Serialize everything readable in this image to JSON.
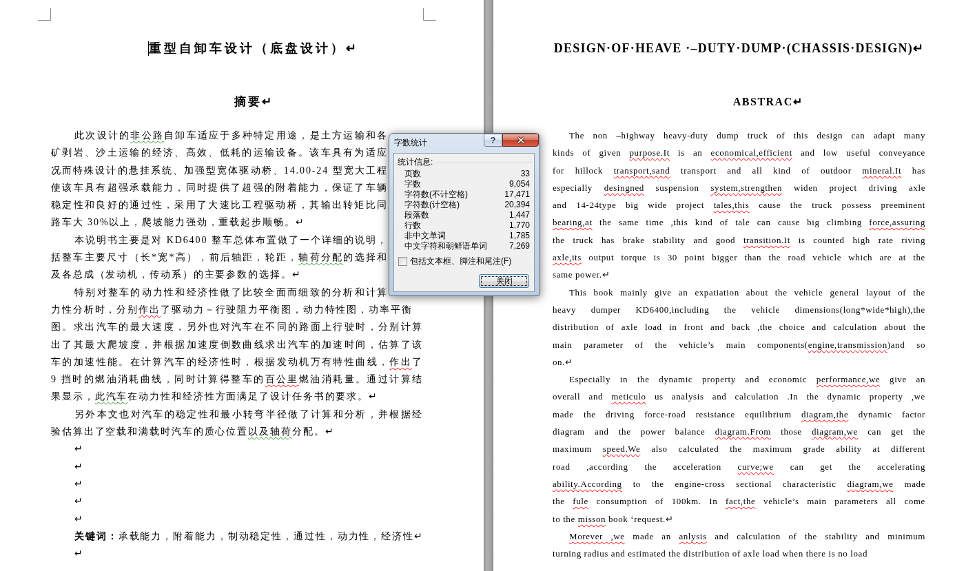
{
  "left_page": {
    "title": {
      "text": "重型自卸车设计（底盘设计）↵",
      "caret": true
    },
    "heading": "摘要↵",
    "paragraphs": [
      {
        "lines": [
          {
            "runs": [
              {
                "text": "此次设计的"
              },
              {
                "text": "非公路",
                "grammar_error": true
              },
              {
                "text": "自卸车适应于多种特定用途，是土方运输和各"
              }
            ]
          },
          {
            "runs": [
              {
                "text": "矿剥岩、沙土运输的经济、高效、低耗的运输设备。该车具有为适应"
              }
            ]
          },
          {
            "runs": [
              {
                "text": "况而特殊设计的悬挂系统、加强型宽体驱动桥、14.00-24 型宽大工程"
              }
            ]
          },
          {
            "runs": [
              {
                "text": "使该车具有超强承载能力，同时提供了超强的附着能力，保证了车辆"
              }
            ]
          },
          {
            "runs": [
              {
                "text": "稳定性和良好的通过性，采用了大速比工程驱动桥，其输出转矩比同"
              }
            ]
          },
          {
            "runs": [
              {
                "text": "路车大 30%以上，爬坡能力强劲，重载起步顺畅。↵"
              }
            ]
          }
        ]
      },
      {
        "lines": [
          {
            "runs": [
              {
                "text": "本说明书主要是对 KD6400 整车总体布置做了一个详细的说明，"
              }
            ]
          },
          {
            "runs": [
              {
                "text": "括整车主要尺寸（长*宽*高），前后轴距，轮距，"
              },
              {
                "text": "轴荷分配",
                "grammar_error": true
              },
              {
                "text": "的选择和"
              }
            ]
          },
          {
            "runs": [
              {
                "text": "及各总成（发动机，传动系）的主要参数的选择。↵"
              }
            ]
          }
        ]
      },
      {
        "lines": [
          {
            "runs": [
              {
                "text": "特别对整车的动力性和经济性做了比较全面而细致的分析和计算"
              }
            ]
          },
          {
            "runs": [
              {
                "text": "力性分析时，分别"
              },
              {
                "text": "作出",
                "spelling_error": true
              },
              {
                "text": "了驱动力－行驶阻力平衡图，动力特性图，功率平衡"
              }
            ]
          },
          {
            "runs": [
              {
                "text": "图。求出汽车的最大速度，另外也对汽车在不同的路面上行驶时，分别计算"
              }
            ]
          },
          {
            "runs": [
              {
                "text": "出了其最大爬坡度，并根据加速度倒数曲线求出汽车的加速时间，估算了该"
              }
            ]
          },
          {
            "runs": [
              {
                "text": "车的加速性能。在计算汽车的经济性时，根据发动机万有特性曲线，"
              },
              {
                "text": "作出",
                "spelling_error": true
              },
              {
                "text": "了"
              }
            ]
          },
          {
            "runs": [
              {
                "text": "9 挡时的燃油消耗曲线，同时计算得整车的"
              },
              {
                "text": "百公里",
                "spelling_error": true
              },
              {
                "text": "燃油消耗量。通过计算结"
              }
            ]
          },
          {
            "runs": [
              {
                "text": "果显示，"
              },
              {
                "text": "此汽车",
                "grammar_error": true
              },
              {
                "text": "在动力性和经济性方面满足了设计任务书的要求。↵"
              }
            ]
          }
        ]
      },
      {
        "lines": [
          {
            "runs": [
              {
                "text": "另外本文也对汽车的稳定性和最小转弯半径做了计算和分析，并根据经"
              }
            ]
          },
          {
            "runs": [
              {
                "text": "验估算出了空载和满载时汽车的质心位置"
              },
              {
                "text": "以及轴荷",
                "grammar_error": true
              },
              {
                "text": "分配。↵"
              }
            ]
          }
        ]
      },
      {
        "lines": [
          {
            "runs": [
              {
                "text": "↵"
              }
            ]
          }
        ]
      },
      {
        "lines": [
          {
            "runs": [
              {
                "text": "↵"
              }
            ]
          }
        ]
      },
      {
        "lines": [
          {
            "runs": [
              {
                "text": "↵"
              }
            ]
          }
        ]
      },
      {
        "lines": [
          {
            "runs": [
              {
                "text": "↵"
              }
            ]
          }
        ]
      },
      {
        "lines": [
          {
            "runs": [
              {
                "text": "↵"
              }
            ]
          }
        ]
      },
      {
        "lines": [
          {
            "runs": [
              {
                "text": "**关键词：**承载能力，附着能力，制动稳定性，通过性，动力性，经济性↵"
              }
            ]
          }
        ]
      },
      {
        "lines": [
          {
            "runs": [
              {
                "text": "↵"
              }
            ]
          }
        ]
      }
    ]
  },
  "right_page": {
    "title": {
      "text": "DESIGN·OF·HEAVE ·–DUTY·DUMP·(CHASSIS·DESIGN)↵"
    },
    "heading": "ABSTRAC↵",
    "paragraphs": [
      {
        "lines": [
          {
            "runs": [
              {
                "text": "The non –highway heavy-duty dump truck of this design can adapt many"
              }
            ]
          },
          {
            "runs": [
              {
                "text": "kinds of given "
              },
              {
                "text": "purpose.It",
                "spelling_error": true
              },
              {
                "text": " is an "
              },
              {
                "text": "economical,efficient",
                "spelling_error": true
              },
              {
                "text": " and low useful conveyance"
              }
            ]
          },
          {
            "runs": [
              {
                "text": "for hillock "
              },
              {
                "text": "transport,sand",
                "spelling_error": true
              },
              {
                "text": " transport and all kind of outdoor "
              },
              {
                "text": "mineral.It",
                "spelling_error": true
              },
              {
                "text": " has"
              }
            ]
          },
          {
            "runs": [
              {
                "text": "especially "
              },
              {
                "text": "desingned",
                "spelling_error": true
              },
              {
                "text": " suspension "
              },
              {
                "text": "system,strengthen",
                "spelling_error": true
              },
              {
                "text": " widen project driving axle"
              }
            ]
          },
          {
            "runs": [
              {
                "text": "and 14-24type big wide project "
              },
              {
                "text": "tales,this",
                "spelling_error": true
              },
              {
                "text": " cause the truck possess preeminent"
              }
            ]
          },
          {
            "runs": [
              {
                "text": "bearing,at",
                "spelling_error": true
              },
              {
                "text": " the same time ,this kind of tale can cause big climbing "
              },
              {
                "text": "force,assuring",
                "spelling_error": true
              }
            ]
          },
          {
            "runs": [
              {
                "text": "the truck has brake stability and good "
              },
              {
                "text": "transition.It",
                "spelling_error": true
              },
              {
                "text": " is counted high rate riving"
              }
            ]
          },
          {
            "runs": [
              {
                "text": "axle,its",
                "spelling_error": true
              },
              {
                "text": " output torque is 30 point bigger than the road vehicle which are at the"
              }
            ]
          },
          {
            "runs": [
              {
                "text": "same power.↵"
              }
            ]
          }
        ]
      },
      {
        "lines": [
          {
            "runs": [
              {
                "text": "This book mainly give an expatiation about the vehicle general layout of the"
              }
            ]
          },
          {
            "runs": [
              {
                "text": "heavy dumper KD6400,including the vehicle dimensions(long*wide*high),the"
              }
            ]
          },
          {
            "runs": [
              {
                "text": "distribution of axle load in front and back ,the choice and calculation about the"
              }
            ]
          },
          {
            "runs": [
              {
                "text": "main parameter of the vehicle’s main components("
              },
              {
                "text": "engine,transmission",
                "spelling_error": true
              },
              {
                "text": ")and so"
              }
            ]
          },
          {
            "runs": [
              {
                "text": "on.↵"
              }
            ]
          }
        ]
      },
      {
        "lines": [
          {
            "runs": [
              {
                "text": "Especially in the dynamic property and economic "
              },
              {
                "text": "performance,we",
                "spelling_error": true
              },
              {
                "text": " give an"
              }
            ]
          },
          {
            "runs": [
              {
                "text": "overall and "
              },
              {
                "text": "meticulo",
                "spelling_error": true
              },
              {
                "text": " us analysis and calculation .In the dynamic property ,we"
              }
            ]
          },
          {
            "runs": [
              {
                "text": "made the driving force-road resistance equilibrium "
              },
              {
                "text": "diagram,the",
                "spelling_error": true
              },
              {
                "text": " dynamic factor"
              }
            ]
          },
          {
            "runs": [
              {
                "text": "diagram and the power balance "
              },
              {
                "text": "diagram.From",
                "spelling_error": true
              },
              {
                "text": " those "
              },
              {
                "text": "diagram,we",
                "spelling_error": true
              },
              {
                "text": " can get the"
              }
            ]
          },
          {
            "runs": [
              {
                "text": "maximum "
              },
              {
                "text": "speed.We",
                "spelling_error": true
              },
              {
                "text": " also calculated the maximum grade ability at different"
              }
            ]
          },
          {
            "runs": [
              {
                "text": "road ,according the acceleration "
              },
              {
                "text": "curve;we",
                "spelling_error": true
              },
              {
                "text": " can get the accelerating"
              }
            ]
          },
          {
            "runs": [
              {
                "text": "ability.According",
                "spelling_error": true
              },
              {
                "text": " to the engine-cross sectional characteristic "
              },
              {
                "text": "diagram,we",
                "spelling_error": true
              },
              {
                "text": " made"
              }
            ]
          },
          {
            "runs": [
              {
                "text": "the "
              },
              {
                "text": "fule",
                "spelling_error": true
              },
              {
                "text": " consumption of 100km. In "
              },
              {
                "text": "fact,the",
                "spelling_error": true
              },
              {
                "text": " vehicle’s main parameters all come"
              }
            ]
          },
          {
            "runs": [
              {
                "text": "to the "
              },
              {
                "text": "misson",
                "spelling_error": true
              },
              {
                "text": " book ‘request.↵"
              }
            ]
          }
        ]
      },
      {
        "lines": [
          {
            "runs": [
              {
                "text": "Morever ,we",
                "spelling_error": true
              },
              {
                "text": " made an "
              },
              {
                "text": "anlysis",
                "spelling_error": true
              },
              {
                "text": " and calculation of the stability and minimum"
              }
            ]
          },
          {
            "runs": [
              {
                "text": "turning radius and estimated the distribution of axle load when there is no load"
              }
            ]
          }
        ]
      }
    ]
  },
  "word_count_dialog": {
    "title": "字数统计",
    "help_label": "?",
    "group_label": "统计信息:",
    "stats": [
      {
        "label": "页数",
        "value": "33"
      },
      {
        "label": "字数",
        "value": "9,054"
      },
      {
        "label": "字符数(不计空格)",
        "value": "17,471"
      },
      {
        "label": "字符数(计空格)",
        "value": "20,394"
      },
      {
        "label": "段落数",
        "value": "1,447"
      },
      {
        "label": "行数",
        "value": "1,770"
      },
      {
        "label": "非中文单词",
        "value": "1,785"
      },
      {
        "label": "中文字符和朝鲜语单词",
        "value": "7,269"
      }
    ],
    "include_option": {
      "label": "包括文本框、脚注和尾注(F)",
      "checked": false
    },
    "close_button": "关闭"
  }
}
